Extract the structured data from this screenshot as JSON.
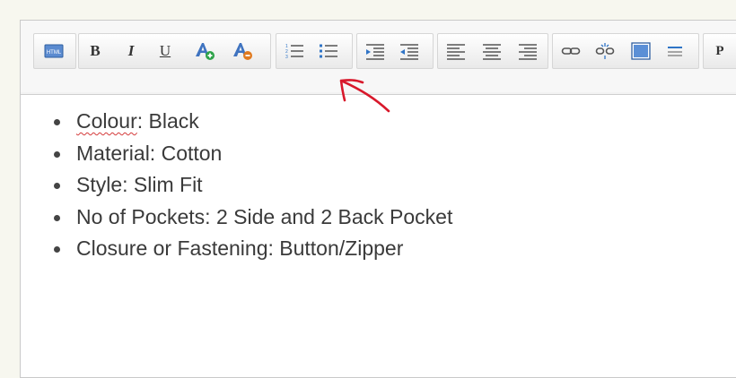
{
  "toolbar": {
    "html_button_label": "HTML",
    "bold_label": "B",
    "italic_label": "I",
    "underline_label": "U",
    "paragraph_label": "P"
  },
  "content": {
    "items": [
      {
        "key": "Colour",
        "rest": ": Black"
      },
      {
        "key": "",
        "rest": "Material: Cotton"
      },
      {
        "key": "",
        "rest": "Style: Slim Fit"
      },
      {
        "key": "",
        "rest": "No of Pockets: 2 Side and 2 Back Pocket"
      },
      {
        "key": "",
        "rest": "Closure or Fastening: Button/Zipper"
      }
    ]
  },
  "colors": {
    "annotation": "#d8182b",
    "accent": "#2f74c6"
  },
  "icons": {
    "html": "html-icon",
    "text_color": "text-color-icon",
    "bg_color": "background-color-icon",
    "ordered_list": "ordered-list-icon",
    "unordered_list": "unordered-list-icon",
    "indent": "indent-icon",
    "outdent": "outdent-icon",
    "align_left": "align-left-icon",
    "align_center": "align-center-icon",
    "align_right": "align-right-icon",
    "link": "link-icon",
    "unlink": "unlink-icon",
    "image": "image-icon",
    "hr": "horizontal-rule-icon"
  }
}
